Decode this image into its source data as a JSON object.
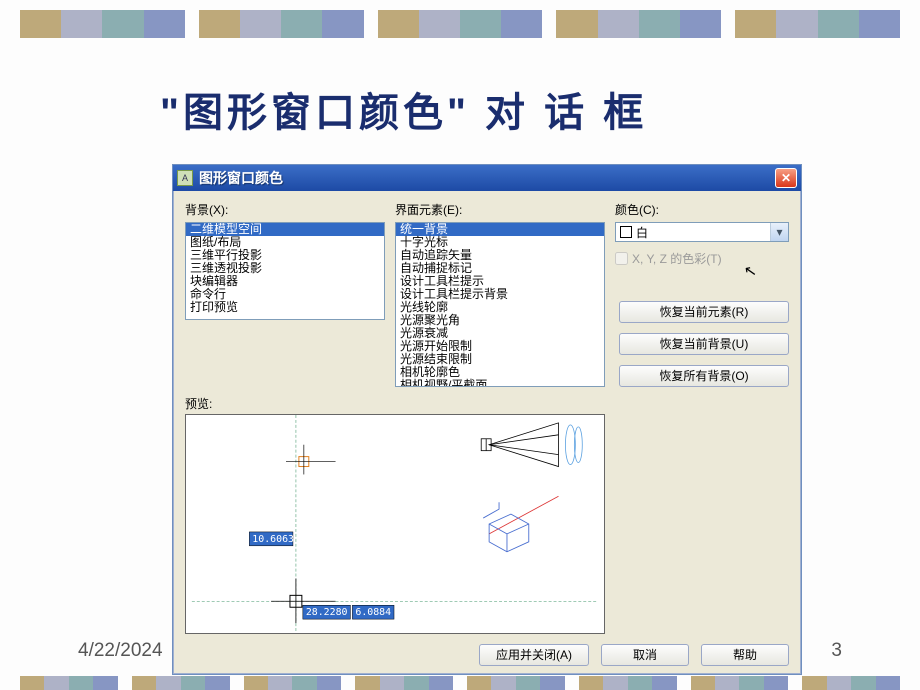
{
  "slide": {
    "title": "\"图形窗口颜色\" 对 话 框",
    "date": "4/22/2024",
    "page": "3"
  },
  "bars": {
    "colors_top": [
      [
        "#bea97a",
        "#aeb2c7",
        "#8baeb1",
        "#8796c3"
      ],
      [
        "#bea97a",
        "#aeb2c7",
        "#8baeb1",
        "#8796c3"
      ],
      [
        "#bea97a",
        "#aeb2c7",
        "#8baeb1",
        "#8796c3"
      ],
      [
        "#bea97a",
        "#aeb2c7",
        "#8baeb1",
        "#8796c3"
      ],
      [
        "#bea97a",
        "#aeb2c7",
        "#8baeb1",
        "#8796c3"
      ]
    ]
  },
  "dialog": {
    "title": "图形窗口颜色",
    "labels": {
      "context": "背景(X):",
      "element": "界面元素(E):",
      "color": "颜色(C):",
      "tint": "X, Y, Z 的色彩(T)",
      "preview": "预览:"
    },
    "context_items": [
      "二维模型空间",
      "图纸/布局",
      "三维平行投影",
      "三维透视投影",
      "块编辑器",
      "命令行",
      "打印预览"
    ],
    "context_selected": 0,
    "element_items": [
      "统一背景",
      "十字光标",
      "自动追踪矢量",
      "自动捕捉标记",
      "设计工具栏提示",
      "设计工具栏提示背景",
      "光线轮廓",
      "光源聚光角",
      "光源衰减",
      "光源开始限制",
      "光源结束限制",
      "相机轮廓色",
      "相机视野/平截面"
    ],
    "element_selected": 0,
    "color_value": "白",
    "buttons": {
      "restore_element": "恢复当前元素(R)",
      "restore_bg": "恢复当前背景(U)",
      "restore_all": "恢复所有背景(O)",
      "apply_close": "应用并关闭(A)",
      "cancel": "取消",
      "help": "帮助"
    },
    "preview": {
      "dim1": "10.6063",
      "dim2": "28.2280",
      "dim3": "6.0884"
    }
  }
}
